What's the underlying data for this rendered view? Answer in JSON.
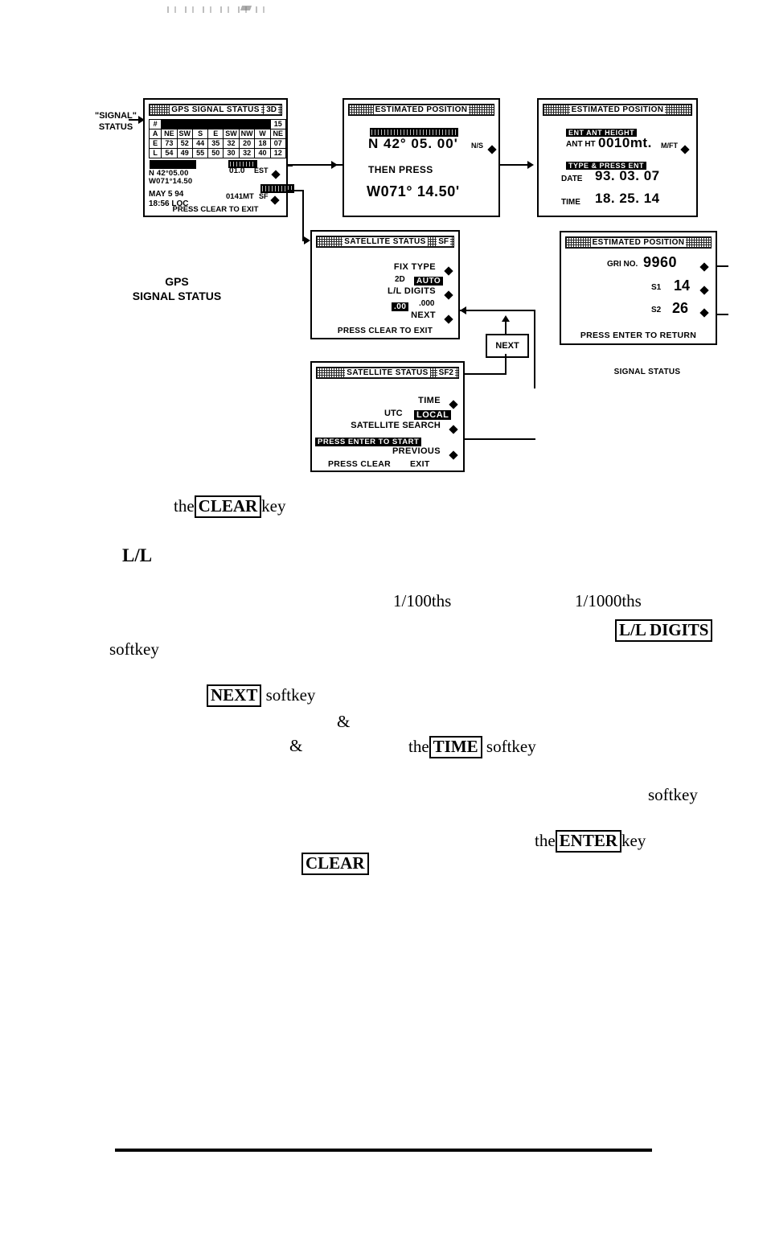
{
  "page": {
    "artifact_note": ""
  },
  "diagram": {
    "left_label": {
      "line1": "\"SIGNAL\"",
      "line2": "STATUS"
    },
    "caption_gps": {
      "line1": "GPS",
      "line2": "SIGNAL STATUS"
    },
    "caption_signal": "SIGNAL STATUS",
    "next_box": "NEXT",
    "screen_gps": {
      "title": "GPS  SIGNAL STATUS",
      "title_right": "3D",
      "count": "15",
      "row_labels": [
        "#",
        "A",
        "E",
        "L"
      ],
      "rows": {
        "A": [
          "NE",
          "SW",
          "S",
          "E",
          "SW",
          "NW",
          "W",
          "NE"
        ],
        "E": [
          "73",
          "52",
          "44",
          "35",
          "32",
          "20",
          "18",
          "07"
        ],
        "L": [
          "54",
          "49",
          "55",
          "50",
          "30",
          "32",
          "40",
          "12"
        ]
      },
      "lat": "N   42°05.00",
      "lon": "W071°14.50",
      "date": "MAY 5 94",
      "time": "18:56 LOC",
      "hdop": "01.0",
      "est_key": "EST",
      "mt": "0141MT",
      "sf_key": "SF",
      "footer": "PRESS  CLEAR TO EXIT"
    },
    "screen_estpos_latlon": {
      "title": "ESTIMATED POSITION",
      "highlight_bar": "",
      "lat": "N  42° 05. 00'",
      "ns_key": "N/S",
      "then_press": "THEN PRESS",
      "lon": "W071° 14.50'"
    },
    "screen_estpos_ant": {
      "title": "ESTIMATED POSITION",
      "bar1": "ENT ANT HEIGHT",
      "ant_label": "ANT HT",
      "ant_value": "0010mt.",
      "mft_key": "M/FT",
      "bar2": "TYPE & PRESS ENT",
      "date_label": "DATE",
      "date_value": "93. 03. 07",
      "time_label": "TIME",
      "time_value": "18. 25. 14"
    },
    "screen_sat_sf": {
      "title": "SATELLITE  STATUS",
      "title_right": "SF",
      "fix_type_label": "FIX TYPE",
      "fix_2d": "2D",
      "fix_value": "AUTO",
      "ll_digits_label": "L/L DIGITS",
      "ll_value_sel": ".00",
      "ll_value_alt": ".000",
      "next_label": "NEXT",
      "footer": "PRESS CLEAR TO EXIT"
    },
    "screen_sat_sf2": {
      "title": "SATELLITE  STATUS",
      "title_right": "SF2",
      "time_label": "TIME",
      "utc_label": "UTC",
      "utc_value": "LOCAL",
      "sat_search_label": "SATELLITE SEARCH",
      "sat_search_bar": "PRESS ENTER TO START",
      "previous_label": "PREVIOUS",
      "footer_left": "PRESS CLEAR",
      "footer_right": "EXIT"
    },
    "screen_estpos_gri": {
      "title": "ESTIMATED POSITION",
      "gri_label": "GRI NO.",
      "gri_value": "9960",
      "s1_label": "S1",
      "s1_value": "14",
      "s2_label": "S2",
      "s2_value": "26",
      "footer": "PRESS ENTER TO RETURN"
    }
  },
  "body": {
    "line_clear": {
      "pre": "the",
      "key": "CLEAR",
      "post": "key"
    },
    "line_ll": "L/L",
    "line_100ths": "1/100ths",
    "line_1000ths": "1/1000ths",
    "key_ll_digits": "L/L DIGITS",
    "line_softkey_1": "softkey",
    "line_next": {
      "key": "NEXT",
      "post": "softkey"
    },
    "amp_1": "&",
    "amp_2": "&",
    "line_time": {
      "pre": "the",
      "key": "TIME",
      "post": "softkey"
    },
    "line_softkey_2": "softkey",
    "line_enter": {
      "pre": "the",
      "key": "ENTER",
      "post": "key"
    },
    "key_clear_bottom": "CLEAR"
  }
}
